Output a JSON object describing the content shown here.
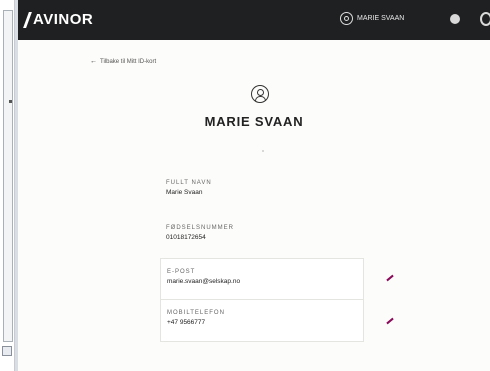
{
  "header": {
    "brand": "AVINOR",
    "user_name": "MARIE SVAAN"
  },
  "main": {
    "back_link": "Tilbake til Mitt ID-kort",
    "profile_name": "MARIE SVAAN",
    "fields": [
      {
        "label": "FULLT NAVN",
        "value": "Marie Svaan"
      },
      {
        "label": "FØDSELSNUMMER",
        "value": "01018172654"
      },
      {
        "label": "E-POST",
        "value": "marie.svaan@selskap.no"
      },
      {
        "label": "MOBILTELEFON",
        "value": "+47 9566777"
      }
    ]
  },
  "colors": {
    "topbar": "#1f2022",
    "accent": "#8a0a5a",
    "background": "#fcfcfa"
  },
  "icons": [
    "user-icon",
    "edit-icon",
    "arrow-left-icon"
  ]
}
